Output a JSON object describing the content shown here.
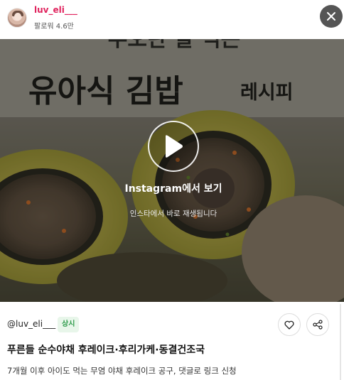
{
  "header": {
    "username": "luv_eli___",
    "followers": "팔로워 4.6만"
  },
  "video": {
    "overlay_text_line1": "유아식 김밥",
    "overlay_text_line2": "레시피",
    "overlay_text_top": "두오란 잘 먹는",
    "watch_label": "Instagram에서 보기",
    "watch_subtext": "인스타에서 바로 재생됩니다"
  },
  "post": {
    "handle": "@luv_eli___",
    "badge": "상시",
    "title": "푸른들 순수야채 후레이크·후리가케·동결건조국",
    "description": "7개월 이후 아이도 먹는 무염 야채 후레이크 공구, 댓글로 링크 신청"
  },
  "colors": {
    "username": "#e0245e",
    "badge_bg": "#e8f6ea",
    "badge_text": "#2e9b4b",
    "close_bg": "#555555"
  },
  "icons": {
    "close": "close-icon",
    "play": "play-icon",
    "like": "heart-icon",
    "share": "share-icon"
  }
}
